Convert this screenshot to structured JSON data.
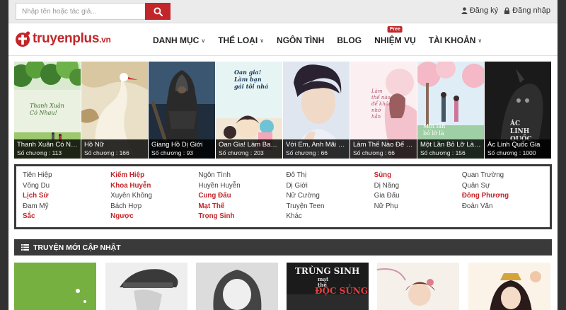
{
  "search": {
    "placeholder": "Nhập tên hoặc tác giả..."
  },
  "auth": {
    "register": "Đăng ký",
    "login": "Đăng nhập"
  },
  "logo": {
    "name": "truyenplus",
    "tld": ".vn"
  },
  "nav": [
    {
      "label": "DANH MỤC",
      "dropdown": true
    },
    {
      "label": "THỂ LOẠI",
      "dropdown": true
    },
    {
      "label": "NGÔN TÌNH",
      "dropdown": false
    },
    {
      "label": "BLOG",
      "dropdown": false
    },
    {
      "label": "NHIỆM VỤ",
      "dropdown": false,
      "badge": "Free"
    },
    {
      "label": "TÀI KHOẢN",
      "dropdown": true
    }
  ],
  "covers": [
    {
      "title": "Thanh Xuân Có Nh...",
      "chapters_label": "Số chương :",
      "chapters": "113",
      "art_text": [
        "Thanh Xuân",
        "Có Nhau!"
      ]
    },
    {
      "title": "Hồ Nữ",
      "chapters_label": "Số chương :",
      "chapters": "166"
    },
    {
      "title": "Giang Hồ Dị Giới",
      "chapters_label": "Số chương :",
      "chapters": "93"
    },
    {
      "title": "Oan Gia! Làm Ban ...",
      "chapters_label": "Số chương :",
      "chapters": "203",
      "art_text": [
        "Oan gia!",
        "Làm bạn",
        "gái tôi nhá"
      ]
    },
    {
      "title": "Với Em, Anh Mãi L...",
      "chapters_label": "Số chương :",
      "chapters": "66"
    },
    {
      "title": "Làm Thế Nào Để K...",
      "chapters_label": "Số chương :",
      "chapters": "66",
      "art_text": [
        "Làm",
        "thế nào",
        "để không",
        "nhớ",
        "hắn"
      ]
    },
    {
      "title": "Một Lần Bỏ Lỡ Là ...",
      "chapters_label": "Số chương :",
      "chapters": "156",
      "art_text": [
        "Một lần",
        "bỏ lỡ là"
      ]
    },
    {
      "title": "Ác Linh Quốc Gia",
      "chapters_label": "Số chương :",
      "chapters": "1000",
      "art_text": [
        "ÁC",
        "LINH",
        "QUỐC"
      ]
    }
  ],
  "genres": [
    {
      "label": "Tiên Hiệp",
      "hot": false
    },
    {
      "label": "Võng Du",
      "hot": false
    },
    {
      "label": "Lịch Sử",
      "hot": true
    },
    {
      "label": "Đam Mỹ",
      "hot": false
    },
    {
      "label": "Sắc",
      "hot": true
    },
    {
      "label": "Kiếm Hiệp",
      "hot": true
    },
    {
      "label": "Khoa Huyễn",
      "hot": true
    },
    {
      "label": "Xuyên Không",
      "hot": false
    },
    {
      "label": "Bách Hợp",
      "hot": false
    },
    {
      "label": "Ngược",
      "hot": true
    },
    {
      "label": "Ngôn Tình",
      "hot": false
    },
    {
      "label": "Huyền Huyễn",
      "hot": false
    },
    {
      "label": "Cung Đấu",
      "hot": true
    },
    {
      "label": "Mạt Thế",
      "hot": true
    },
    {
      "label": "Trọng Sinh",
      "hot": true
    },
    {
      "label": "Đô Thị",
      "hot": false
    },
    {
      "label": "Dị Giới",
      "hot": false
    },
    {
      "label": "Nữ Cường",
      "hot": false
    },
    {
      "label": "Truyện Teen",
      "hot": false
    },
    {
      "label": "Khác",
      "hot": false
    },
    {
      "label": "Sủng",
      "hot": true
    },
    {
      "label": "Dị Năng",
      "hot": false
    },
    {
      "label": "Gia Đấu",
      "hot": false
    },
    {
      "label": "Nữ Phụ",
      "hot": false
    },
    {
      "label": "",
      "hot": false
    },
    {
      "label": "Quan Trường",
      "hot": false
    },
    {
      "label": "Quân Sự",
      "hot": false
    },
    {
      "label": "Đông Phương",
      "hot": true
    },
    {
      "label": "Đoản Văn",
      "hot": false
    },
    {
      "label": "",
      "hot": false
    }
  ],
  "section": {
    "title": "TRUYỆN MỚI CẬP NHẬT"
  },
  "thumbs": [
    {
      "art_text": []
    },
    {
      "art_text": []
    },
    {
      "art_text": []
    },
    {
      "art_text": [
        "TRÙNG SINH",
        "mạt",
        "thế",
        "ĐỘC SỦNG"
      ]
    },
    {
      "art_text": []
    },
    {
      "art_text": []
    }
  ],
  "colors": {
    "accent": "#c2262a",
    "dark_bar": "#3a3a3a",
    "topbar": "#ebebeb"
  }
}
